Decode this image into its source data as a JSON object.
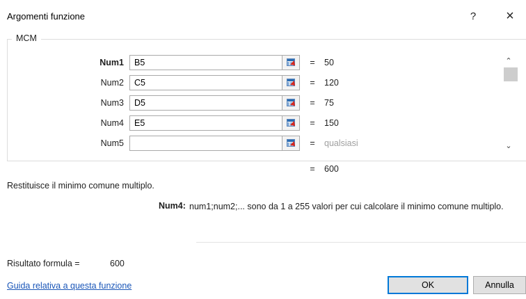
{
  "window": {
    "title": "Argomenti funzione",
    "help_label": "?",
    "close_label": "×"
  },
  "function": {
    "name": "MCM",
    "args": [
      {
        "label": "Num1",
        "value": "B5",
        "result": "50",
        "bold": true
      },
      {
        "label": "Num2",
        "value": "C5",
        "result": "120",
        "bold": false
      },
      {
        "label": "Num3",
        "value": "D5",
        "result": "75",
        "bold": false
      },
      {
        "label": "Num4",
        "value": "E5",
        "result": "150",
        "bold": false
      },
      {
        "label": "Num5",
        "value": "",
        "result": "qualsiasi",
        "bold": false
      }
    ],
    "equals": "=",
    "overall_result": "600",
    "description": "Restituisce il minimo comune multiplo.",
    "arg_help_label": "Num4:",
    "arg_help_text": "num1;num2;... sono da 1 a 255 valori per cui calcolare il minimo comune multiplo."
  },
  "footer": {
    "formula_result_label": "Risultato formula =",
    "formula_result_value": "600",
    "help_link": "Guida relativa a questa funzione",
    "ok_label": "OK",
    "cancel_label": "Annulla"
  },
  "icons": {
    "scroll_up": "chevron-up-icon",
    "scroll_down": "chevron-down-icon",
    "collapse": "collapse-dialog-icon"
  },
  "colors": {
    "link": "#1a56b8",
    "default_button_border": "#0078d7"
  }
}
